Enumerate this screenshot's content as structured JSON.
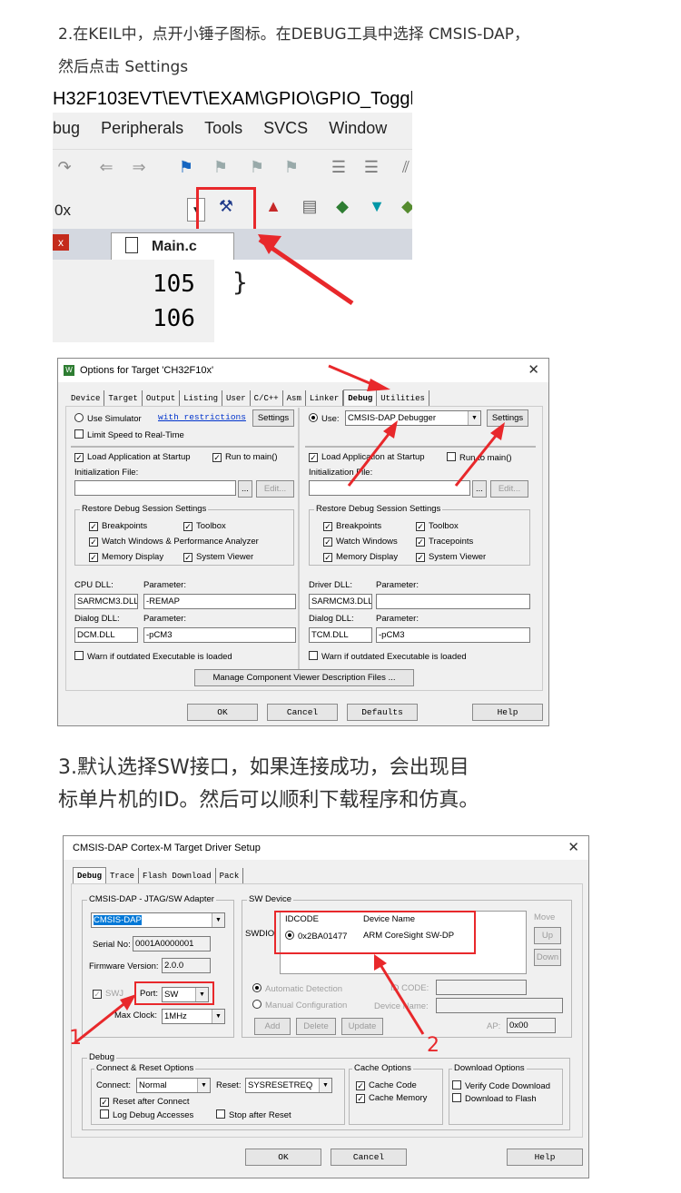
{
  "text": {
    "step2_line1": "2.在KEIL中，点开小锤子图标。在DEBUG工具中选择 CMSIS-DAP，",
    "step2_line2": "然后点击 Settings",
    "step3_line1": "3.默认选择SW接口，如果连接成功，会出现目",
    "step3_line2": "标单片机的ID。然后可以顺利下载程序和仿真。"
  },
  "keil": {
    "path": "H32F103EVT\\EVT\\EXAM\\GPIO\\GPIO_Toggl",
    "menu": [
      "bug",
      "Peripherals",
      "Tools",
      "SVCS",
      "Window"
    ],
    "address": "0x",
    "tab": "Main.c",
    "lines": [
      "105",
      "106"
    ],
    "code": "}"
  },
  "options": {
    "title": "Options for Target 'CH32F10x'",
    "tabs": [
      "Device",
      "Target",
      "Output",
      "Listing",
      "User",
      "C/C++",
      "Asm",
      "Linker",
      "Debug",
      "Utilities"
    ],
    "active_tab": "Debug",
    "left": {
      "use_simulator": "Use Simulator",
      "restrictions": "with restrictions",
      "settings": "Settings",
      "limit_speed": "Limit Speed to Real-Time",
      "load_app": "Load Application at Startup",
      "run_main": "Run to main()",
      "init_file": "Initialization File:",
      "browse": "...",
      "edit": "Edit...",
      "restore": "Restore Debug Session Settings",
      "breakpoints": "Breakpoints",
      "toolbox": "Toolbox",
      "watch": "Watch Windows & Performance Analyzer",
      "memory": "Memory Display",
      "system_viewer": "System Viewer",
      "cpu_dll": "CPU DLL:",
      "parameter": "Parameter:",
      "cpu_dll_val": "SARMCM3.DLL",
      "cpu_param_val": "-REMAP",
      "dialog_dll": "Dialog DLL:",
      "dialog_dll_val": "DCM.DLL",
      "dialog_param_val": "-pCM3",
      "warn": "Warn if outdated Executable is loaded"
    },
    "right": {
      "use": "Use:",
      "debugger": "CMSIS-DAP Debugger",
      "settings": "Settings",
      "load_app": "Load Application at Startup",
      "run_main": "Run to main()",
      "init_file": "Initialization File:",
      "browse": "...",
      "edit": "Edit...",
      "restore": "Restore Debug Session Settings",
      "breakpoints": "Breakpoints",
      "toolbox": "Toolbox",
      "watch": "Watch Windows",
      "tracepoints": "Tracepoints",
      "memory": "Memory Display",
      "system_viewer": "System Viewer",
      "driver_dll": "Driver DLL:",
      "parameter": "Parameter:",
      "driver_dll_val": "SARMCM3.DLL",
      "dialog_dll": "Dialog DLL:",
      "dialog_dll_val": "TCM.DLL",
      "dialog_param_val": "-pCM3",
      "warn": "Warn if outdated Executable is loaded"
    },
    "manage": "Manage Component Viewer Description Files ...",
    "ok": "OK",
    "cancel": "Cancel",
    "defaults": "Defaults",
    "help": "Help"
  },
  "driver": {
    "title": "CMSIS-DAP Cortex-M Target Driver Setup",
    "tabs": [
      "Debug",
      "Trace",
      "Flash Download",
      "Pack"
    ],
    "active_tab": "Debug",
    "adapter_group": "CMSIS-DAP - JTAG/SW Adapter",
    "adapter": "CMSIS-DAP",
    "serial_label": "Serial No:",
    "serial": "0001A0000001",
    "fw_label": "Firmware Version:",
    "fw": "2.0.0",
    "swj": "SWJ",
    "port_label": "Port:",
    "port": "SW",
    "clock_label": "Max Clock:",
    "clock": "1MHz",
    "sw_group": "SW Device",
    "col_idcode": "IDCODE",
    "col_name": "Device Name",
    "swdio": "SWDIO",
    "idcode": "0x2BA01477",
    "device_name": "ARM CoreSight SW-DP",
    "move": "Move",
    "up": "Up",
    "down": "Down",
    "auto_detect": "Automatic Detection",
    "manual": "Manual Configuration",
    "id_code": "ID CODE:",
    "device_name_label": "Device Name:",
    "add": "Add",
    "delete": "Delete",
    "update": "Update",
    "ap": "AP:",
    "ap_val": "0x00",
    "debug_group": "Debug",
    "connect_group": "Connect & Reset Options",
    "connect_label": "Connect:",
    "connect": "Normal",
    "reset_label": "Reset:",
    "reset": "SYSRESETREQ",
    "reset_after": "Reset after Connect",
    "log_debug": "Log Debug Accesses",
    "stop_after": "Stop after Reset",
    "cache_group": "Cache Options",
    "cache_code": "Cache Code",
    "cache_memory": "Cache Memory",
    "download_group": "Download Options",
    "verify": "Verify Code Download",
    "download_flash": "Download to Flash",
    "ok": "OK",
    "cancel": "Cancel",
    "help": "Help"
  },
  "annotations": {
    "n1": "1",
    "n2": "2"
  },
  "colors": {
    "highlight": "#e8282b",
    "selection": "#0078d7"
  }
}
